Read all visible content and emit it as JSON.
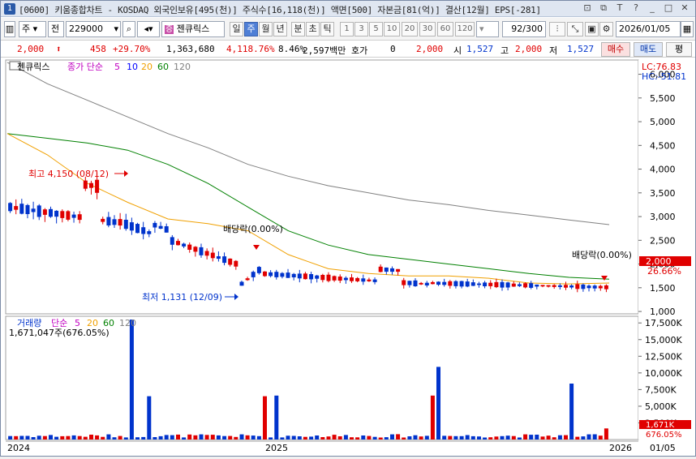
{
  "window": {
    "title": "[0600] 키움종합차트 - KOSDAQ 외국인보유[495(천)] 주식수[16,118(천)] 액면[500] 자본금[81(억)] 결산[12월] EPS[-281]",
    "badge": "1",
    "controls": [
      "⊡",
      "⧉",
      "T",
      "?",
      "_",
      "□",
      "✕"
    ]
  },
  "toolbar": {
    "market_select": "주",
    "scope_select": "전",
    "code_input": "229000",
    "stock_name": "젠큐릭스",
    "period_tabs": [
      "일",
      "주",
      "월",
      "년",
      "분",
      "초",
      "틱"
    ],
    "period_selected": "주",
    "interval_buttons": [
      "1",
      "3",
      "5",
      "10",
      "20",
      "30",
      "60",
      "120"
    ],
    "count": "92/300",
    "date": "2026/01/05"
  },
  "quote": {
    "price": "2,000",
    "change": "458",
    "change_pct": "+29.70%",
    "volume": "1,363,680",
    "volume_pct": "4,118.76%",
    "turnover": "8.46%",
    "amount": "2,597백만",
    "bid_label": "호가",
    "bid_value": "0",
    "hoga_price": "2,000",
    "open_label": "시",
    "open": "1,527",
    "high_label": "고",
    "high": "2,000",
    "low_label": "저",
    "low": "1,527",
    "buy_label": "매수",
    "sell_label": "매도",
    "eval_label": "평"
  },
  "chart_legend": {
    "name": "젠큐릭스",
    "series_label": "종가 단순",
    "ma": [
      "5",
      "10",
      "20",
      "60",
      "120"
    ],
    "lc": "LC:76.83",
    "hc": "HC:-51.81",
    "current_price": "2,000",
    "current_pct": "26.66%",
    "high_note": "최고 4,150 (08/12)",
    "low_note": "최저 1,131 (12/09)",
    "dividend_1": "배당락(0.00%)",
    "dividend_2": "배당락(0.00%)"
  },
  "volume_legend": {
    "label": "거래량",
    "ma_label": "단순",
    "ma": [
      "5",
      "20",
      "60",
      "120"
    ],
    "value": "1,671,047주(676.05%)",
    "current_vol": "1,671K",
    "current_vol_pct": "676.05%"
  },
  "axis": {
    "price_ticks": [
      "6,000",
      "5,500",
      "5,000",
      "4,500",
      "4,000",
      "3,500",
      "3,000",
      "2,500",
      "2,000",
      "1,500",
      "1,000"
    ],
    "volume_ticks": [
      "17,500K",
      "15,000K",
      "12,500K",
      "10,000K",
      "7,500K",
      "5,000K",
      "2,500K"
    ],
    "x_labels": [
      "2024",
      "2025",
      "2026"
    ],
    "x_right": "01/05"
  },
  "colors": {
    "up": "#e00000",
    "down": "#0033cc",
    "ma5": "#c000c0",
    "ma10": "#0000ff",
    "ma20": "#f0a000",
    "ma60": "#008000",
    "ma120": "#808080"
  },
  "chart_data": {
    "type": "candlestick",
    "title": "젠큐릭스",
    "x_range": [
      "2024",
      "2026/01/05"
    ],
    "ylim": [
      950,
      6300
    ],
    "y2lim": [
      0,
      18500
    ],
    "ma_120": [
      6250,
      5800,
      5450,
      5100,
      4750,
      4450,
      4100,
      3850,
      3650,
      3500,
      3350,
      3250,
      3130,
      3030,
      2930,
      2830
    ],
    "ma_60": [
      4750,
      4650,
      4550,
      4400,
      4100,
      3700,
      3200,
      2700,
      2400,
      2200,
      2100,
      2000,
      1900,
      1800,
      1720,
      1680
    ],
    "ma_20": [
      4750,
      4300,
      3700,
      3300,
      2950,
      2850,
      2700,
      2200,
      1900,
      1800,
      1750,
      1750,
      1700,
      1600,
      1580,
      1600
    ],
    "volume_peak": 18000,
    "last_volume": 1671
  }
}
